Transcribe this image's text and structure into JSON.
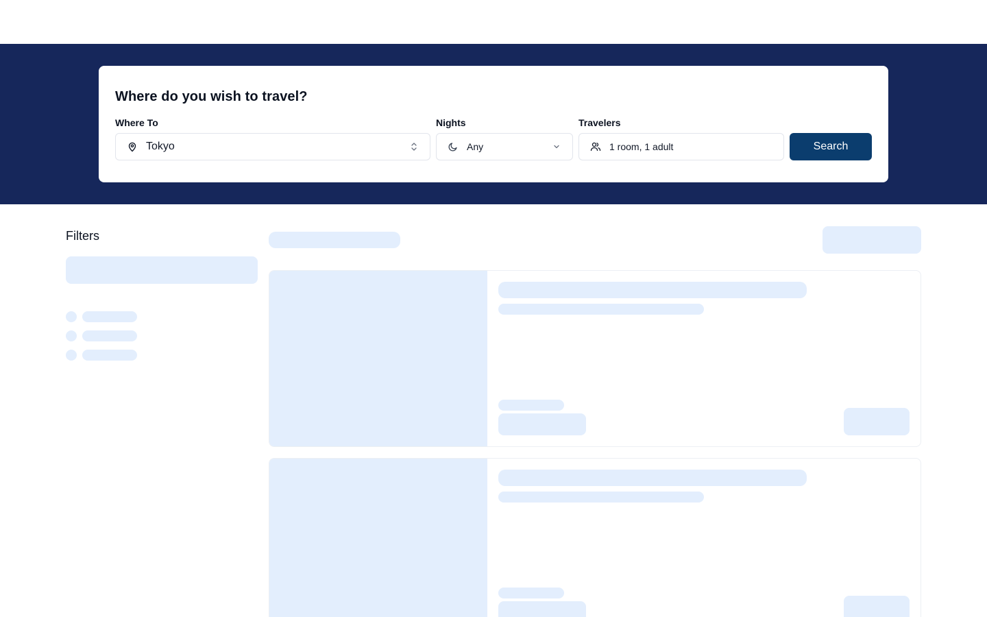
{
  "search": {
    "title": "Where do you wish to travel?",
    "where_label": "Where To",
    "where_value": "Tokyo",
    "nights_label": "Nights",
    "nights_value": "Any",
    "travelers_label": "Travelers",
    "travelers_value": "1 room, 1 adult",
    "search_button": "Search"
  },
  "filters": {
    "title": "Filters"
  },
  "colors": {
    "hero_bg": "#16275b",
    "primary_button": "#0b3d6e",
    "skeleton": "#e3eefd"
  },
  "icons": {
    "where": "map-pin-icon",
    "where_trail": "chevron-up-down-icon",
    "nights": "moon-icon",
    "nights_trail": "chevron-down-icon",
    "travelers": "users-icon"
  }
}
